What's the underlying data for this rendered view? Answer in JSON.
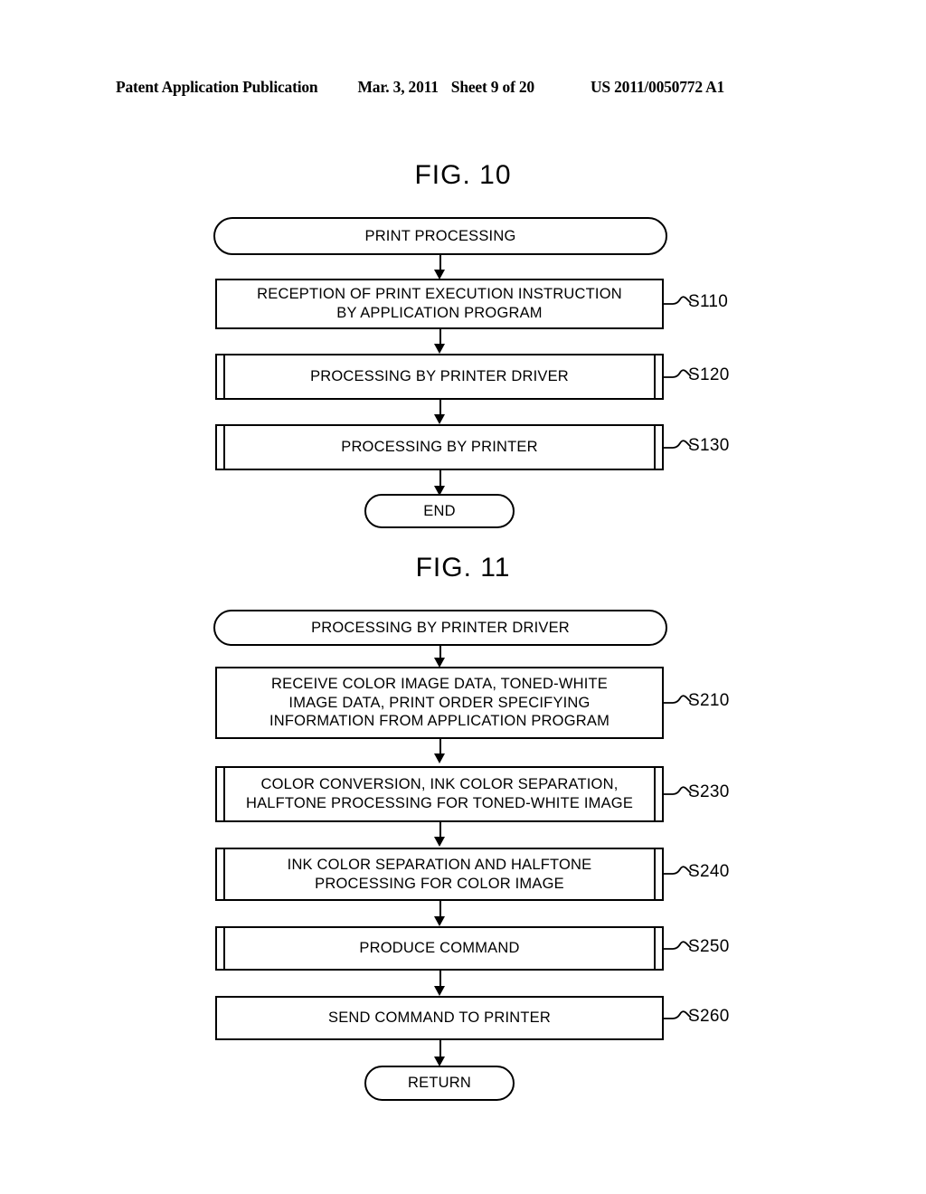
{
  "header": {
    "publication": "Patent Application Publication",
    "date": "Mar. 3, 2011",
    "sheet": "Sheet 9 of 20",
    "number": "US 2011/0050772 A1"
  },
  "figures": [
    {
      "title": "FIG. 10",
      "nodes": [
        {
          "id": "fig10-start",
          "shape": "terminator",
          "text": "PRINT PROCESSING"
        },
        {
          "id": "fig10-s110",
          "shape": "process",
          "text": "RECEPTION OF PRINT EXECUTION INSTRUCTION\nBY APPLICATION PROGRAM",
          "step": "S110"
        },
        {
          "id": "fig10-s120",
          "shape": "subroutine",
          "text": "PROCESSING BY PRINTER DRIVER",
          "step": "S120"
        },
        {
          "id": "fig10-s130",
          "shape": "subroutine",
          "text": "PROCESSING BY PRINTER",
          "step": "S130"
        },
        {
          "id": "fig10-end",
          "shape": "terminator",
          "text": "END"
        }
      ]
    },
    {
      "title": "FIG. 11",
      "nodes": [
        {
          "id": "fig11-start",
          "shape": "terminator",
          "text": "PROCESSING BY PRINTER DRIVER"
        },
        {
          "id": "fig11-s210",
          "shape": "process",
          "text": "RECEIVE COLOR IMAGE DATA, TONED-WHITE\nIMAGE DATA, PRINT ORDER SPECIFYING\nINFORMATION FROM APPLICATION PROGRAM",
          "step": "S210"
        },
        {
          "id": "fig11-s230",
          "shape": "subroutine",
          "text": "COLOR CONVERSION, INK COLOR SEPARATION,\nHALFTONE PROCESSING FOR TONED-WHITE IMAGE",
          "step": "S230"
        },
        {
          "id": "fig11-s240",
          "shape": "subroutine",
          "text": "INK COLOR SEPARATION AND HALFTONE\nPROCESSING FOR COLOR IMAGE",
          "step": "S240"
        },
        {
          "id": "fig11-s250",
          "shape": "subroutine",
          "text": "PRODUCE COMMAND",
          "step": "S250"
        },
        {
          "id": "fig11-s260",
          "shape": "process",
          "text": "SEND COMMAND TO PRINTER",
          "step": "S260"
        },
        {
          "id": "fig11-return",
          "shape": "terminator",
          "text": "RETURN"
        }
      ]
    }
  ],
  "colors": {
    "ink": "#000000",
    "paper": "#ffffff"
  }
}
